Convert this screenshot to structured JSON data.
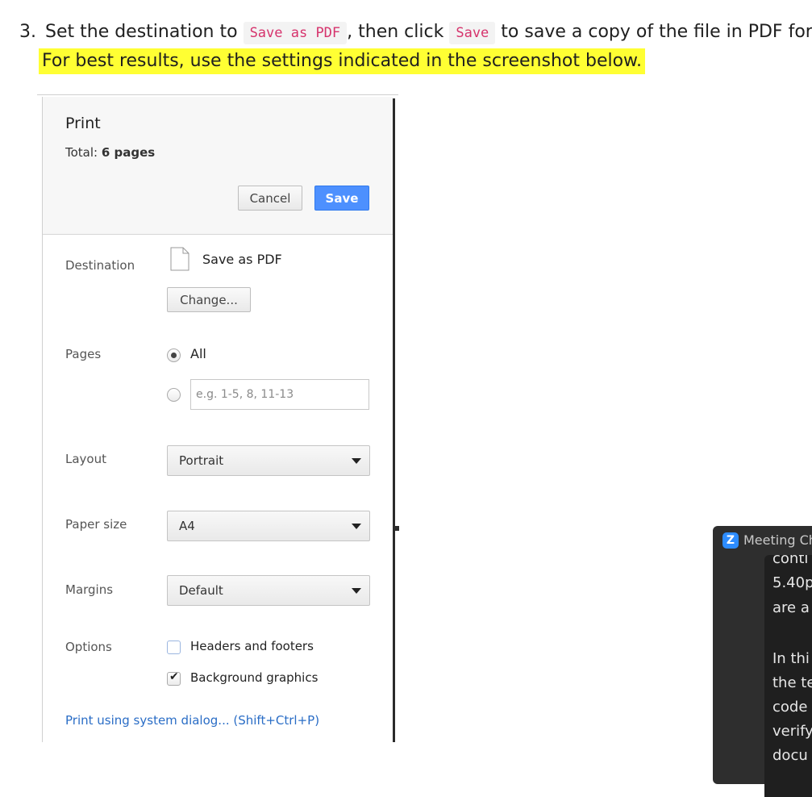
{
  "instructions": {
    "step_number": "3.",
    "text_a": "Set the destination to",
    "code_dest": "Save as PDF",
    "text_b": ", then click",
    "code_save": "Save",
    "text_c": "to save a copy of the file in PDF format",
    "highlight": "For best results, use the settings indicated in the screenshot below."
  },
  "dialog": {
    "title": "Print",
    "total_label": "Total:",
    "total_value": "6 pages",
    "cancel": "Cancel",
    "save": "Save",
    "destination_label": "Destination",
    "destination_value": "Save as PDF",
    "change": "Change...",
    "pages_label": "Pages",
    "pages_all": "All",
    "pages_placeholder": "e.g. 1-5, 8, 11-13",
    "layout_label": "Layout",
    "layout_value": "Portrait",
    "paper_label": "Paper size",
    "paper_value": "A4",
    "margins_label": "Margins",
    "margins_value": "Default",
    "options_label": "Options",
    "opt_headers": "Headers and footers",
    "opt_headers_checked": false,
    "opt_background": "Background graphics",
    "opt_background_checked": true,
    "system_dialog": "Print using system dialog... (Shift+Ctrl+P)"
  },
  "zoom_chat": {
    "logo": "Z",
    "title": "Meeting Ch",
    "lines": [
      "conti",
      "5.40p",
      "are a",
      "",
      "In thi",
      "the te",
      "code",
      "verify",
      "docu"
    ]
  }
}
